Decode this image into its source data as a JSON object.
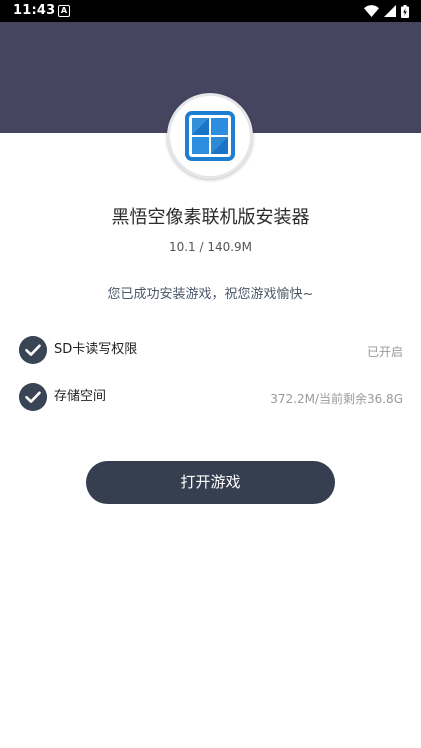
{
  "status_bar": {
    "time": "11:43",
    "notification_letter": "A"
  },
  "app": {
    "title": "黑悟空像素联机版安装器",
    "size": "10.1 / 140.9M",
    "success_message": "您已成功安装游戏，祝您游戏愉快~"
  },
  "permissions": [
    {
      "label": "SD卡读写权限",
      "value": "已开启"
    },
    {
      "label": "存储空间",
      "value": "372.2M/当前剩余36.8G"
    }
  ],
  "actions": {
    "open_label": "打开游戏"
  },
  "colors": {
    "header": "#46455f",
    "button": "#353f50",
    "check": "#394454",
    "logo_blue": "#1e7fd0"
  }
}
